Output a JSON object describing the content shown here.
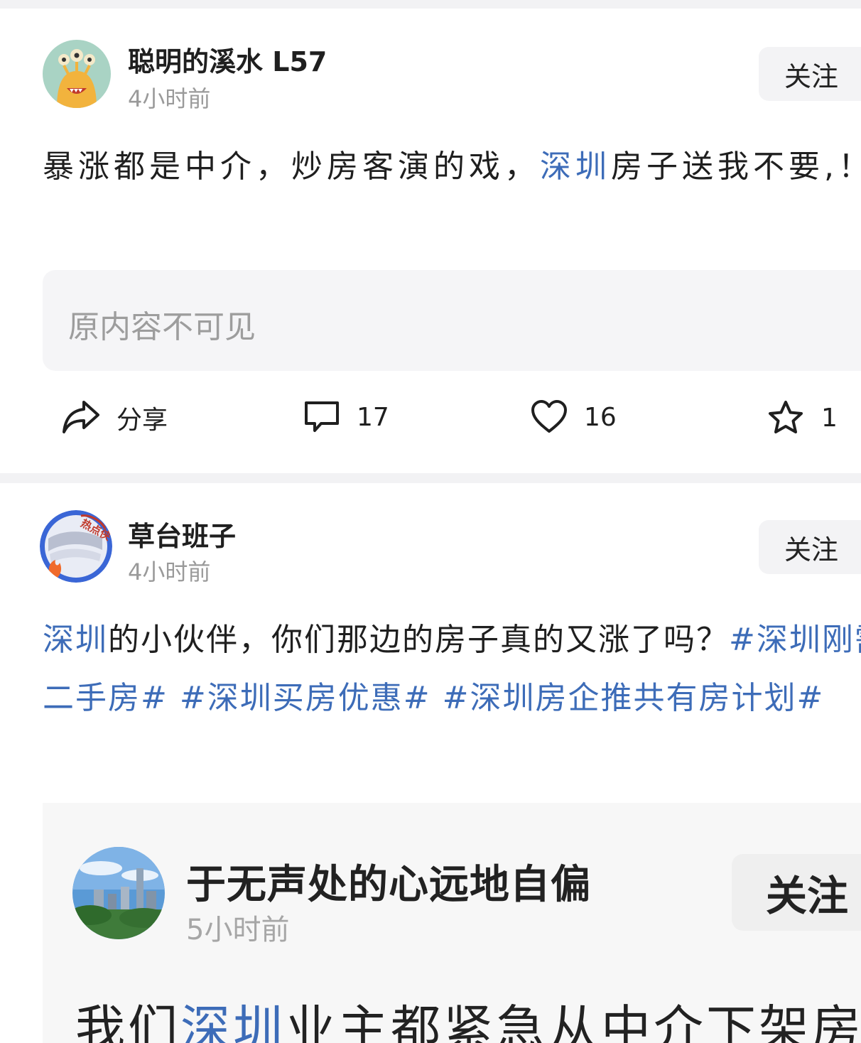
{
  "posts": [
    {
      "username": "聪明的溪水 L57",
      "time": "4小时前",
      "follow_label": "关注",
      "body": {
        "part1": "暴涨都是中介，炒房客演的戏，",
        "link": "深圳",
        "part2": "房子送我不要,！"
      },
      "quote_text": "原内容不可见",
      "actions": {
        "share_label": "分享",
        "comments": "17",
        "likes": "16",
        "favorites": "1"
      }
    },
    {
      "username": "草台班子",
      "time": "4小时前",
      "follow_label": "关注",
      "avatar_badge": "热点侠",
      "body": {
        "link1": "深圳",
        "text": "的小伙伴，你们那边的房子真的又涨了吗？",
        "tags": "#深圳刚需二手房# #深圳买房优惠# #深圳房企推共有房计划#"
      },
      "embed": {
        "username": "于无声处的心远地自偏",
        "time": "5小时前",
        "follow_label": "关注",
        "text_part1": "我们",
        "text_link": "深圳",
        "text_part2": "业主都紧急从中介下架房"
      }
    }
  ],
  "colors": {
    "link": "#3d6cb8",
    "divider": "#f2f2f4",
    "muted": "#9a9a9a"
  }
}
